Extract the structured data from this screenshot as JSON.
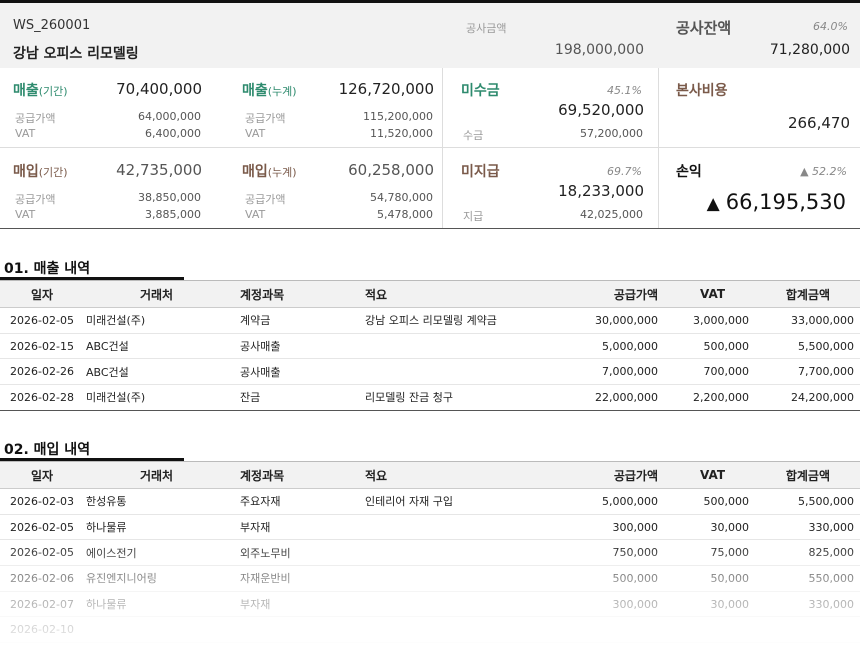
{
  "header": {
    "code": "WS_260001",
    "project_name": "강남 오피스 리모델링",
    "contract_label": "공사금액",
    "contract_value": "198,000,000",
    "balance_label": "공사잔액",
    "balance_pct": "64.0%",
    "balance_value": "71,280,000"
  },
  "summary": {
    "sales_period": {
      "label": "매출",
      "sub": "(기간)",
      "value": "70,400,000",
      "supply_label": "공급가액",
      "supply_value": "64,000,000",
      "vat_label": "VAT",
      "vat_value": "6,400,000"
    },
    "sales_cumulative": {
      "label": "매출",
      "sub": "(누계)",
      "value": "126,720,000",
      "supply_label": "공급가액",
      "supply_value": "115,200,000",
      "vat_label": "VAT",
      "vat_value": "11,520,000"
    },
    "receivable": {
      "label": "미수금",
      "pct": "45.1%",
      "value": "69,520,000",
      "sub_label": "수금",
      "sub_value": "57,200,000"
    },
    "hq_cost": {
      "label": "본사비용",
      "value": "266,470"
    },
    "purchase_period": {
      "label": "매입",
      "sub": "(기간)",
      "value": "42,735,000",
      "supply_label": "공급가액",
      "supply_value": "38,850,000",
      "vat_label": "VAT",
      "vat_value": "3,885,000"
    },
    "purchase_cumulative": {
      "label": "매입",
      "sub": "(누계)",
      "value": "60,258,000",
      "supply_label": "공급가액",
      "supply_value": "54,780,000",
      "vat_label": "VAT",
      "vat_value": "5,478,000"
    },
    "payable": {
      "label": "미지급",
      "pct": "69.7%",
      "value": "18,233,000",
      "sub_label": "지급",
      "sub_value": "42,025,000"
    },
    "profit": {
      "label": "손익",
      "pct": "▲ 52.2%",
      "triangle": "▲",
      "value": "66,195,530"
    }
  },
  "columns": {
    "date": "일자",
    "vendor": "거래처",
    "account": "계정과목",
    "memo": "적요",
    "supply": "공급가액",
    "vat": "VAT",
    "total": "합계금액"
  },
  "sales_section": {
    "title": "01. 매출 내역",
    "rows": [
      {
        "date": "2026-02-05",
        "vendor": "미래건설(주)",
        "account": "계약금",
        "memo": "강남 오피스 리모델링 계약금",
        "supply": "30,000,000",
        "vat": "3,000,000",
        "total": "33,000,000"
      },
      {
        "date": "2026-02-15",
        "vendor": "ABC건설",
        "account": "공사매출",
        "memo": "",
        "supply": "5,000,000",
        "vat": "500,000",
        "total": "5,500,000"
      },
      {
        "date": "2026-02-26",
        "vendor": "ABC건설",
        "account": "공사매출",
        "memo": "",
        "supply": "7,000,000",
        "vat": "700,000",
        "total": "7,700,000"
      },
      {
        "date": "2026-02-28",
        "vendor": "미래건설(주)",
        "account": "잔금",
        "memo": "리모델링 잔금 청구",
        "supply": "22,000,000",
        "vat": "2,200,000",
        "total": "24,200,000"
      }
    ]
  },
  "purchase_section": {
    "title": "02. 매입 내역",
    "rows": [
      {
        "date": "2026-02-03",
        "vendor": "한성유통",
        "account": "주요자재",
        "memo": "인테리어 자재 구입",
        "supply": "5,000,000",
        "vat": "500,000",
        "total": "5,500,000"
      },
      {
        "date": "2026-02-05",
        "vendor": "하나물류",
        "account": "부자재",
        "memo": "",
        "supply": "300,000",
        "vat": "30,000",
        "total": "330,000"
      },
      {
        "date": "2026-02-05",
        "vendor": "에이스전기",
        "account": "외주노무비",
        "memo": "",
        "supply": "750,000",
        "vat": "75,000",
        "total": "825,000"
      },
      {
        "date": "2026-02-06",
        "vendor": "유진엔지니어링",
        "account": "자재운반비",
        "memo": "",
        "supply": "500,000",
        "vat": "50,000",
        "total": "550,000"
      },
      {
        "date": "2026-02-07",
        "vendor": "하나물류",
        "account": "부자재",
        "memo": "",
        "supply": "300,000",
        "vat": "30,000",
        "total": "330,000"
      },
      {
        "date": "2026-02-10",
        "vendor": "",
        "account": "",
        "memo": "",
        "supply": "",
        "vat": "",
        "total": ""
      }
    ]
  },
  "colors": {
    "sales_accent": "#2e8b6e",
    "purchase_accent": "#7a5a4a",
    "header_bg": "#f2f2f2"
  }
}
